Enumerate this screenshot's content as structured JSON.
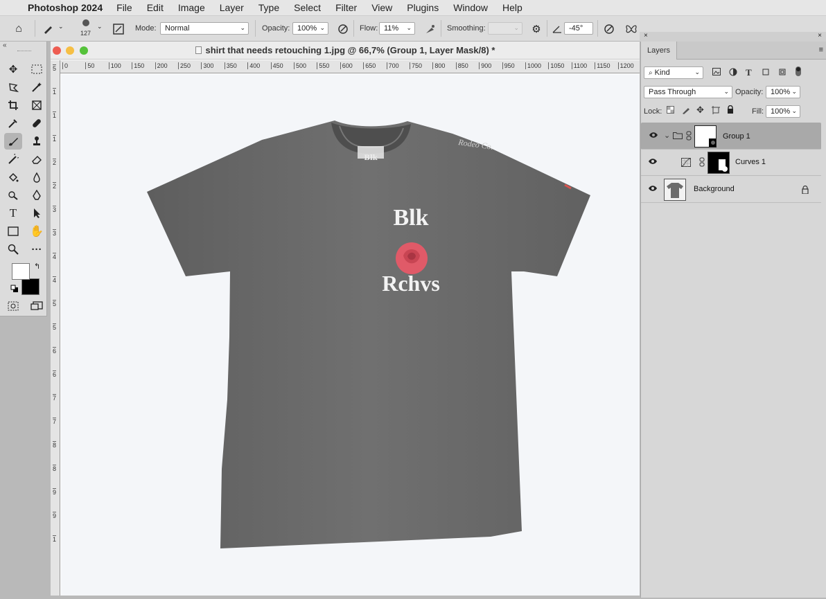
{
  "menubar": {
    "app": "Photoshop 2024",
    "items": [
      "File",
      "Edit",
      "Image",
      "Layer",
      "Type",
      "Select",
      "Filter",
      "View",
      "Plugins",
      "Window",
      "Help"
    ]
  },
  "options": {
    "brush_size": "127",
    "mode_label": "Mode:",
    "mode_value": "Normal",
    "opacity_label": "Opacity:",
    "opacity_value": "100%",
    "flow_label": "Flow:",
    "flow_value": "11%",
    "smoothing_label": "Smoothing:",
    "smoothing_value": "",
    "angle_value": "-45°"
  },
  "document": {
    "title": "shirt that needs retouching 1.jpg @ 66,7% (Group 1, Layer Mask/8) *"
  },
  "ruler": {
    "h": [
      "0",
      "50",
      "100",
      "150",
      "200",
      "250",
      "300",
      "350",
      "400",
      "450",
      "500",
      "550",
      "600",
      "650",
      "700",
      "750",
      "800",
      "850",
      "900",
      "950",
      "1000",
      "1050",
      "1100",
      "1150",
      "1200"
    ],
    "v": [
      "5",
      "1",
      "1",
      "1",
      "2",
      "2",
      "3",
      "3",
      "4",
      "4",
      "5",
      "5",
      "6",
      "6",
      "7",
      "7",
      "8",
      "8",
      "9",
      "9",
      "1"
    ]
  },
  "shirt": {
    "print_top": "Blk",
    "print_bottom": "Rchvs",
    "sleeve_script": "Rodeo Co."
  },
  "layers": {
    "tab": "Layers",
    "filter_kind": "Kind",
    "blend_mode": "Pass Through",
    "opacity_label": "Opacity:",
    "opacity_value": "100%",
    "lock_label": "Lock:",
    "fill_label": "Fill:",
    "fill_value": "100%",
    "rows": [
      {
        "name": "Group 1"
      },
      {
        "name": "Curves 1"
      },
      {
        "name": "Background"
      }
    ]
  },
  "colors": {
    "selected_row": "#a9a9a9",
    "shirt": "#6b6b6b",
    "rose": "#e05a68"
  }
}
